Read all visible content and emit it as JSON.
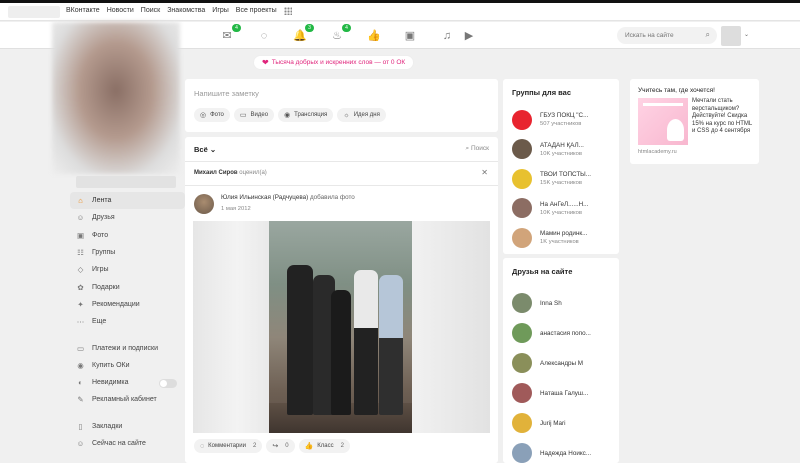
{
  "topnav": {
    "links": [
      "ВКонтакте",
      "Новости",
      "Поиск",
      "Знакомства",
      "Игры",
      "Все проекты"
    ]
  },
  "header": {
    "icons": [
      {
        "name": "mail-icon",
        "glyph": "✉",
        "badge": "4"
      },
      {
        "name": "discussions-icon",
        "glyph": "◌",
        "badge": ""
      },
      {
        "name": "notifications-icon",
        "glyph": "🔔",
        "badge": "3"
      },
      {
        "name": "guests-icon",
        "glyph": "♨",
        "badge": "4"
      },
      {
        "name": "likes-icon",
        "glyph": "👍",
        "badge": ""
      },
      {
        "name": "video-icon",
        "glyph": "▣",
        "badge": ""
      },
      {
        "name": "music-icon",
        "glyph": "♫",
        "badge": ""
      },
      {
        "name": "video-play-icon",
        "glyph": "▶",
        "badge": ""
      }
    ],
    "search_placeholder": "Искать на сайте"
  },
  "promo": {
    "text": "Тысяча добрых и искренних слов — от 0 ОК"
  },
  "sidebar": {
    "items": [
      {
        "label": "Лента",
        "icon": "home-icon",
        "glyph": "⌂",
        "active": true
      },
      {
        "label": "Друзья",
        "icon": "friends-icon",
        "glyph": "☺"
      },
      {
        "label": "Фото",
        "icon": "photo-icon",
        "glyph": "▣"
      },
      {
        "label": "Группы",
        "icon": "groups-icon",
        "glyph": "☷"
      },
      {
        "label": "Игры",
        "icon": "games-icon",
        "glyph": "◇"
      },
      {
        "label": "Подарки",
        "icon": "gifts-icon",
        "glyph": "✿"
      },
      {
        "label": "Рекомендации",
        "icon": "recommendations-icon",
        "glyph": "✦"
      },
      {
        "label": "Еще",
        "icon": "more-icon",
        "glyph": "⋯"
      }
    ],
    "items2": [
      {
        "label": "Платежи и подписки",
        "icon": "payments-icon",
        "glyph": "▭"
      },
      {
        "label": "Купить ОКи",
        "icon": "buy-ok-icon",
        "glyph": "◉"
      },
      {
        "label": "Невидимка",
        "icon": "invisible-icon",
        "glyph": "◐",
        "toggle": true
      },
      {
        "label": "Рекламный кабинет",
        "icon": "ads-icon",
        "glyph": "✎"
      }
    ],
    "items3": [
      {
        "label": "Закладки",
        "icon": "bookmarks-icon",
        "glyph": "▯"
      },
      {
        "label": "Сейчас на сайте",
        "icon": "online-icon",
        "glyph": "☺"
      }
    ]
  },
  "note": {
    "placeholder": "Напишите заметку",
    "actions": [
      {
        "label": "Фото",
        "icon": "camera-icon",
        "glyph": "◎"
      },
      {
        "label": "Видео",
        "icon": "video-cam-icon",
        "glyph": "▭"
      },
      {
        "label": "Трансляция",
        "icon": "stream-icon",
        "glyph": "◉"
      },
      {
        "label": "Идея дня",
        "icon": "idea-icon",
        "glyph": "☼"
      }
    ]
  },
  "feed": {
    "filter": "Всё",
    "search": "Поиск",
    "notice_name": "Михаил Сиров",
    "notice_text": "оценил(а)",
    "post_author": "Юлия Ильинская (Радчуцева)",
    "post_action": "добавила фото",
    "post_date": "1 мая 2012",
    "actions": [
      {
        "label": "Комментарии",
        "count": "2",
        "icon": "comment-icon",
        "glyph": "◌"
      },
      {
        "label": "",
        "count": "0",
        "icon": "share-icon",
        "glyph": "↪"
      },
      {
        "label": "Класс",
        "count": "2",
        "icon": "like-icon",
        "glyph": "👍"
      }
    ]
  },
  "groups": {
    "title": "Группы для вас",
    "items": [
      {
        "name": "ГБУЗ ПОКЦ \"С...",
        "sub": "507 участников",
        "color": "#e8242f"
      },
      {
        "name": "АТАДАН ҚАЛ...",
        "sub": "10K участников",
        "color": "#6b5a4a"
      },
      {
        "name": "ТВОЙ ТОПСТЫ...",
        "sub": "15K участников",
        "color": "#e8c12f"
      },
      {
        "name": "На АнГеЛ......Н...",
        "sub": "10K участников",
        "color": "#8c6d63"
      },
      {
        "name": "Мамин родинк...",
        "sub": "1K участников",
        "color": "#d1a47a"
      }
    ]
  },
  "friends": {
    "title": "Друзья на сайте",
    "items": [
      {
        "name": "Inna Sh",
        "color": "#7b8b6c"
      },
      {
        "name": "анастасия попо...",
        "color": "#6f9a5a"
      },
      {
        "name": "Александры М",
        "color": "#8a8f5a"
      },
      {
        "name": "Наташа Галуш...",
        "color": "#a05a5a"
      },
      {
        "name": "Jurij Mari",
        "color": "#e1b23a"
      },
      {
        "name": "Надежда Ноикс...",
        "color": "#8aa0b8"
      }
    ]
  },
  "ad": {
    "title": "Учитесь там, где хочется!",
    "text": "Мечтали стать верстальщиком? Действуйте! Скидка 15% на курс по HTML и CSS до 4 сентября",
    "domain": "htmlacademy.ru"
  }
}
